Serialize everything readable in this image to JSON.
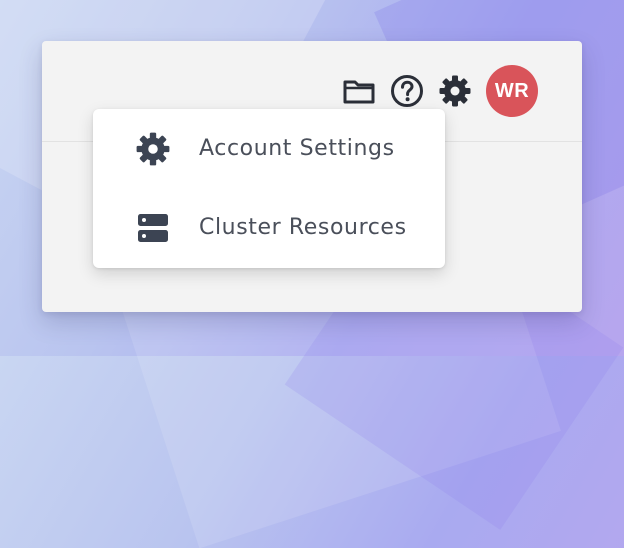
{
  "toolbar": {
    "icons": [
      "folder-icon",
      "help-icon",
      "gear-icon"
    ],
    "avatar_initials": "WR",
    "avatar_color": "#d9545a"
  },
  "menu": {
    "items": [
      {
        "label": "Account Settings",
        "icon": "gear-icon"
      },
      {
        "label": "Cluster Resources",
        "icon": "server-icon"
      }
    ]
  },
  "colors": {
    "icon": "#2b2f38",
    "menu_icon": "#3c4453",
    "menu_text": "#4a4f5a",
    "panel": "#f3f3f3"
  }
}
